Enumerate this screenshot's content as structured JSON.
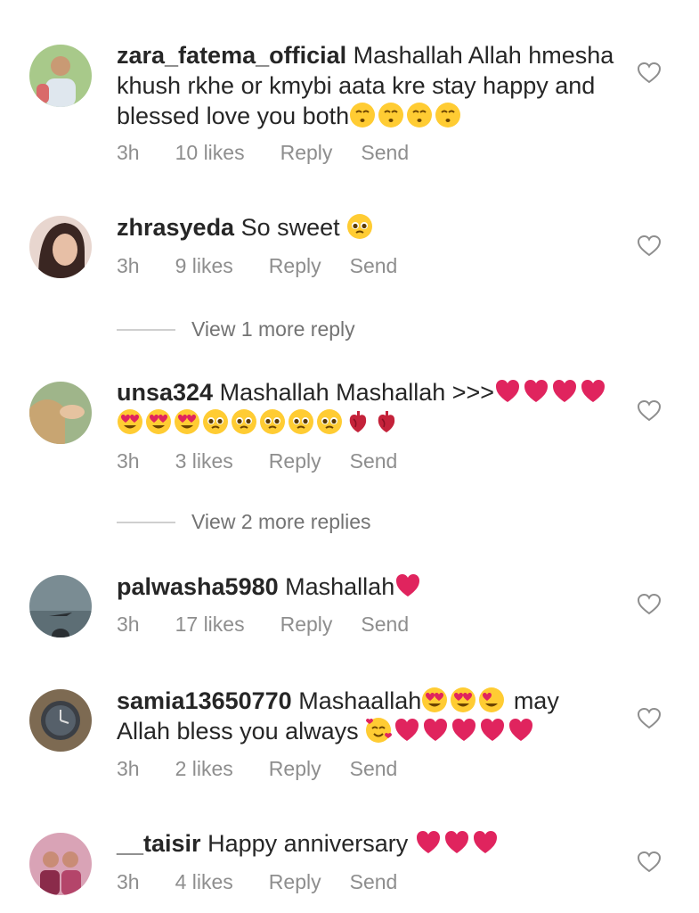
{
  "comments": [
    {
      "username": "zara_fatema_official",
      "text": "Mashallah Allah hmesha khush rkhe or kmybi aata kre stay happy and blessed love you both",
      "emojis": [
        "kissing-smiling-eyes",
        "kissing-smiling-eyes",
        "kissing-smiling-eyes",
        "kissing-smiling-eyes"
      ],
      "time": "3h",
      "likes": "10 likes",
      "reply": "Reply",
      "send": "Send"
    },
    {
      "username": "zhrasyeda",
      "text": "So sweet",
      "emojis": [
        "pleading-face"
      ],
      "time": "3h",
      "likes": "9 likes",
      "reply": "Reply",
      "send": "Send"
    },
    {
      "username": "unsa324",
      "text": "Mashallah Mashallah >>>",
      "emojis": [
        "red-heart",
        "red-heart",
        "red-heart",
        "red-heart",
        "heart-eyes",
        "heart-eyes",
        "heart-eyes",
        "pleading-face",
        "pleading-face",
        "pleading-face",
        "pleading-face",
        "pleading-face",
        "anatomical-heart",
        "anatomical-heart"
      ],
      "time": "3h",
      "likes": "3 likes",
      "reply": "Reply",
      "send": "Send"
    },
    {
      "username": "palwasha5980",
      "text": "Mashallah",
      "emojis": [
        "red-heart"
      ],
      "time": "3h",
      "likes": "17 likes",
      "reply": "Reply",
      "send": "Send"
    },
    {
      "username": "samia13650770",
      "text": "Mashaallah",
      "text_after": "may Allah bless you always",
      "emojis": [
        "heart-eyes",
        "heart-eyes",
        "heart-eyes"
      ],
      "emojis_after": [
        "smiling-face-with-hearts",
        "red-heart",
        "red-heart",
        "red-heart",
        "red-heart",
        "red-heart"
      ],
      "time": "3h",
      "likes": "2 likes",
      "reply": "Reply",
      "send": "Send"
    },
    {
      "username": "__taisir",
      "text": "Happy anniversary",
      "emojis": [
        "red-heart",
        "red-heart",
        "red-heart"
      ],
      "time": "3h",
      "likes": "4 likes",
      "reply": "Reply",
      "send": "Send"
    }
  ],
  "view_more": [
    {
      "label": "View 1 more reply"
    },
    {
      "label": "View 2 more replies"
    }
  ],
  "icons": {
    "like": "heart-outline-icon"
  },
  "colors": {
    "text": "#262626",
    "meta": "#8e8e8e",
    "heart_red": "#e0245e"
  }
}
